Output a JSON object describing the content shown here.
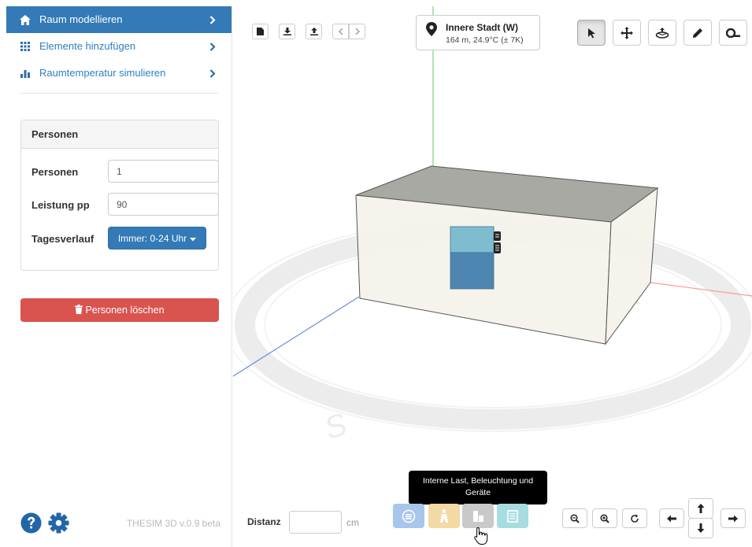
{
  "sidebar": {
    "nav": [
      {
        "label": "Raum modellieren",
        "icon": "home-icon",
        "active": true
      },
      {
        "label": "Elemente hinzufügen",
        "icon": "grid-icon",
        "active": false
      },
      {
        "label": "Raumtemperatur simulieren",
        "icon": "bar-chart-icon",
        "active": false
      }
    ],
    "panel": {
      "title": "Personen",
      "fields": [
        {
          "label": "Personen",
          "value": "1"
        },
        {
          "label": "Leistung pp",
          "value": "90"
        }
      ],
      "schedule_label": "Tagesverlauf",
      "schedule_value": "Immer: 0-24 Uhr"
    },
    "delete_label": "Personen löschen",
    "version": "THESIM 3D v.0.9 beta"
  },
  "toolbar": {
    "file_buttons": [
      "new-file-icon",
      "download-icon",
      "upload-icon",
      "undo-icon",
      "redo-icon"
    ],
    "tools": [
      "select-arrow-icon",
      "move-icon",
      "rotate-icon",
      "pencil-icon",
      "tape-measure-icon"
    ],
    "active_tool": "select-arrow-icon"
  },
  "location": {
    "title": "Innere Stadt (W)",
    "subtitle": "164 m, 24.9°C (± 7K)"
  },
  "compass": {
    "south_label": "S"
  },
  "tooltip": {
    "text_line1": "Interne Last, Beleuchtung und",
    "text_line2": "Geräte"
  },
  "bottom": {
    "distance_label": "Distanz",
    "distance_value": "",
    "distance_unit": "cm"
  },
  "colors": {
    "primary": "#337ab7",
    "danger": "#d9534f",
    "window_top": "#7fbcd0",
    "window_bottom": "#4f86b1"
  }
}
